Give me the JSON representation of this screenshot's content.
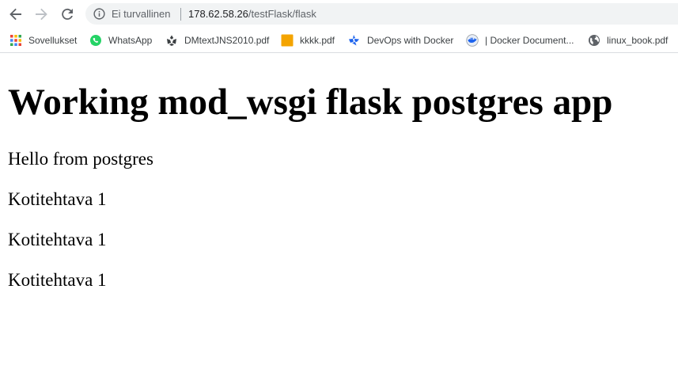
{
  "browser": {
    "security_label": "Ei turvallinen",
    "url_host": "178.62.58.26",
    "url_path": "/testFlask/flask"
  },
  "bookmarks": [
    {
      "label": "Sovellukset",
      "icon": "apps-grid-icon"
    },
    {
      "label": "WhatsApp",
      "icon": "whatsapp-icon"
    },
    {
      "label": "DMtextJNS2010.pdf",
      "icon": "pdf-doc-icon"
    },
    {
      "label": "kkkk.pdf",
      "icon": "orange-square-icon"
    },
    {
      "label": "DevOps with Docker",
      "icon": "docker-icon"
    },
    {
      "label": "| Docker Document...",
      "icon": "docker-docs-icon"
    },
    {
      "label": "linux_book.pdf",
      "icon": "globe-icon"
    }
  ],
  "page": {
    "title": "Working mod_wsgi flask postgres app",
    "paragraphs": [
      "Hello from postgres",
      "Kotitehtava 1",
      "Kotitehtava 1",
      "Kotitehtava 1"
    ]
  },
  "colors": {
    "chrome_text": "#5f6368",
    "omnibox_bg": "#f1f3f4",
    "whatsapp_green": "#25d366",
    "docker_blue": "#1d63ed",
    "kkkk_orange": "#f4a400"
  }
}
